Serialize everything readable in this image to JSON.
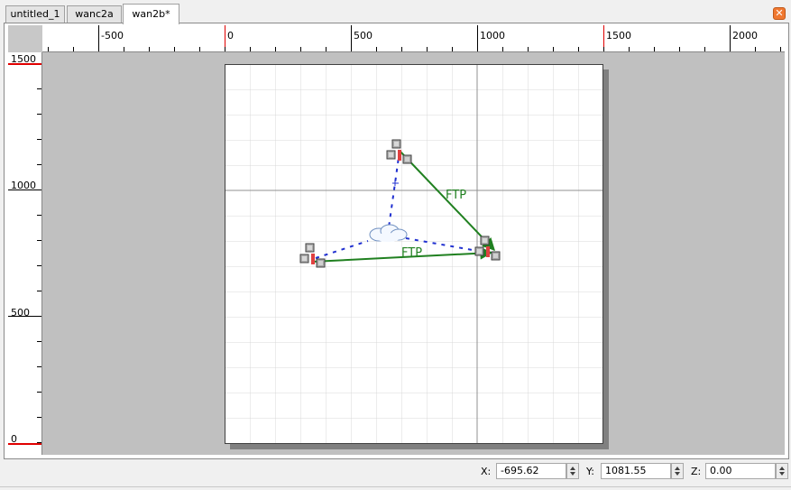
{
  "tabs": [
    {
      "label": "untitled_1",
      "active": false
    },
    {
      "label": "wanc2a",
      "active": false
    },
    {
      "label": "wan2b*",
      "active": true
    }
  ],
  "rulers": {
    "horizontal": [
      "-500",
      "0",
      "500",
      "1000",
      "1500",
      "2000"
    ],
    "vertical": [
      "1500",
      "1000",
      "500",
      "0"
    ]
  },
  "network": {
    "nodes": [
      {
        "id": "node-top",
        "icon": "network-node-icon"
      },
      {
        "id": "node-left",
        "icon": "network-node-icon"
      },
      {
        "id": "node-right",
        "icon": "network-node-icon"
      },
      {
        "id": "wan-cloud",
        "icon": "cloud-icon"
      }
    ],
    "links": [
      {
        "from": "node-top",
        "to": "node-right",
        "label": "FTP",
        "style": "solid",
        "color": "#208020"
      },
      {
        "from": "node-left",
        "to": "node-right",
        "label": "FTP",
        "style": "solid",
        "color": "#208020"
      },
      {
        "from": "node-top",
        "to": "wan-cloud",
        "style": "dashed",
        "color": "#2030d0"
      },
      {
        "from": "node-left",
        "to": "wan-cloud",
        "style": "dashed",
        "color": "#2030d0"
      },
      {
        "from": "node-right",
        "to": "wan-cloud",
        "style": "dashed",
        "color": "#2030d0"
      }
    ]
  },
  "status": {
    "x_label": "X:",
    "x_value": "-695.62",
    "y_label": "Y:",
    "y_value": "1081.55",
    "z_label": "Z:",
    "z_value": "0.00"
  },
  "colors": {
    "accent": "#e00000",
    "flow": "#208020",
    "wan_link": "#2030d0",
    "close": "#f07830"
  }
}
